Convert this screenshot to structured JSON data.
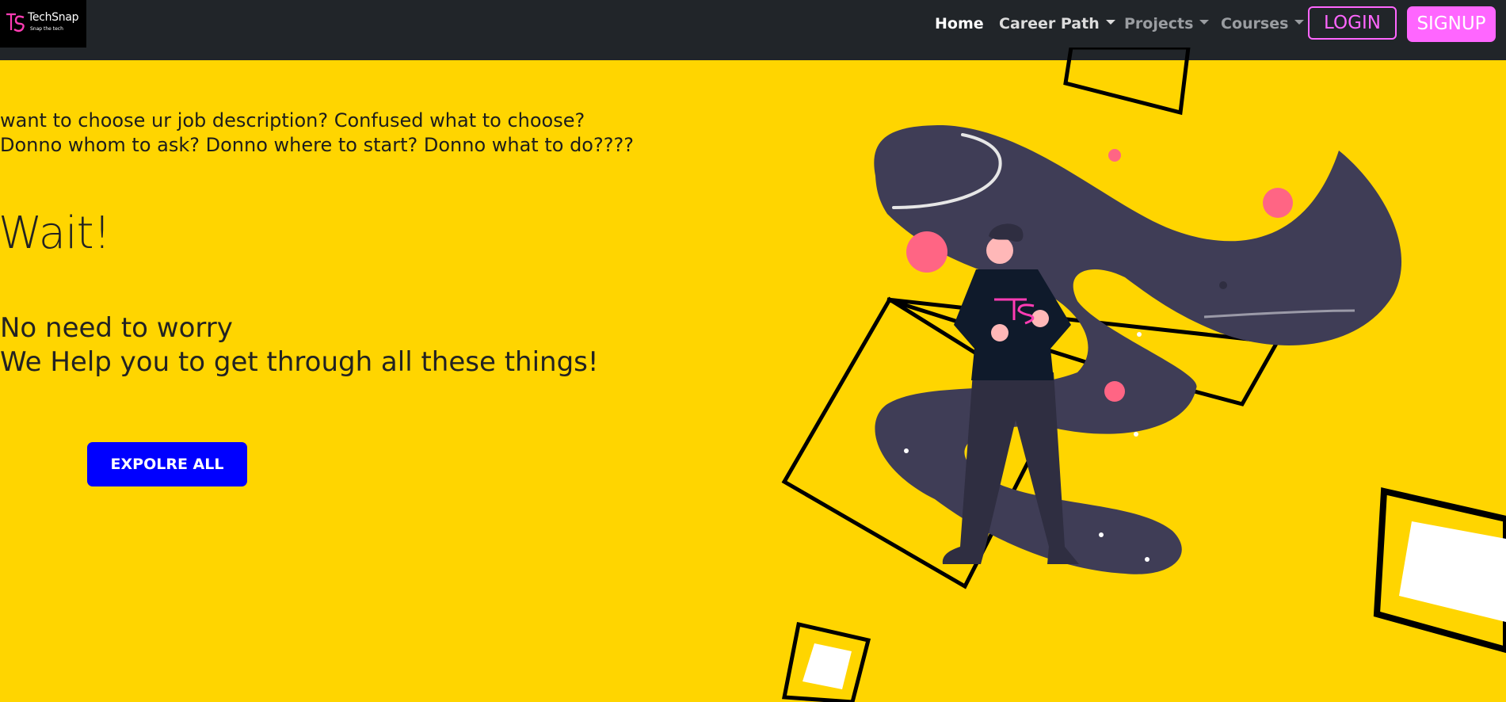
{
  "brand": {
    "name": "TechSnap",
    "tagline": "Snap the tech"
  },
  "nav": {
    "items": [
      {
        "label": "Home",
        "active": true
      },
      {
        "label": "Career Path",
        "dropdown": true
      },
      {
        "label": "Projects",
        "dropdown": true
      },
      {
        "label": "Courses",
        "dropdown": true
      }
    ],
    "login_label": "LOGIN",
    "signup_label": "SIGNUP"
  },
  "hero": {
    "intro_line1": "want to choose ur job description? Confused what to choose?",
    "intro_line2": "Donno whom to ask? Donno where to start? Donno what to do????",
    "heading": "Wait!",
    "subline1": "No need to worry",
    "subline2": "We Help you to get through all these things!",
    "cta_label": "EXPOLRE ALL"
  },
  "colors": {
    "background": "#FFD500",
    "navbar": "#212529",
    "accent_pink": "#FF66FF",
    "cta_blue": "#0000FF"
  },
  "icons": {
    "logo": "techsnap-logo-icon"
  }
}
